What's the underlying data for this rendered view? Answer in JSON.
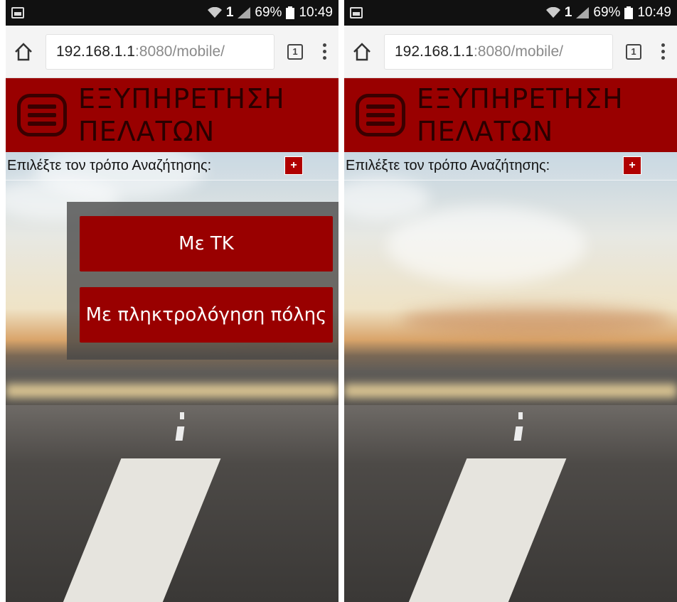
{
  "status_bar": {
    "battery": "69%",
    "time": "10:49",
    "sim": "1"
  },
  "browser": {
    "url_host": "192.168.1.1",
    "url_rest": ":8080/mobile/",
    "tab_count": "1"
  },
  "header": {
    "title_line1": "ΕΞΥΠΗΡΕΤΗΣΗ",
    "title_line2": "ΠΕΛΑΤΩΝ"
  },
  "search": {
    "label": "Επιλέξτε τον τρόπο Αναζήτησης:",
    "plus": "+"
  },
  "popup": {
    "option_postal": "Με ΤΚ",
    "option_city": "Με πληκτρολόγηση πόλης"
  },
  "colors": {
    "header_red": "#990000",
    "button_red": "#990000",
    "status_bar": "#111111"
  }
}
